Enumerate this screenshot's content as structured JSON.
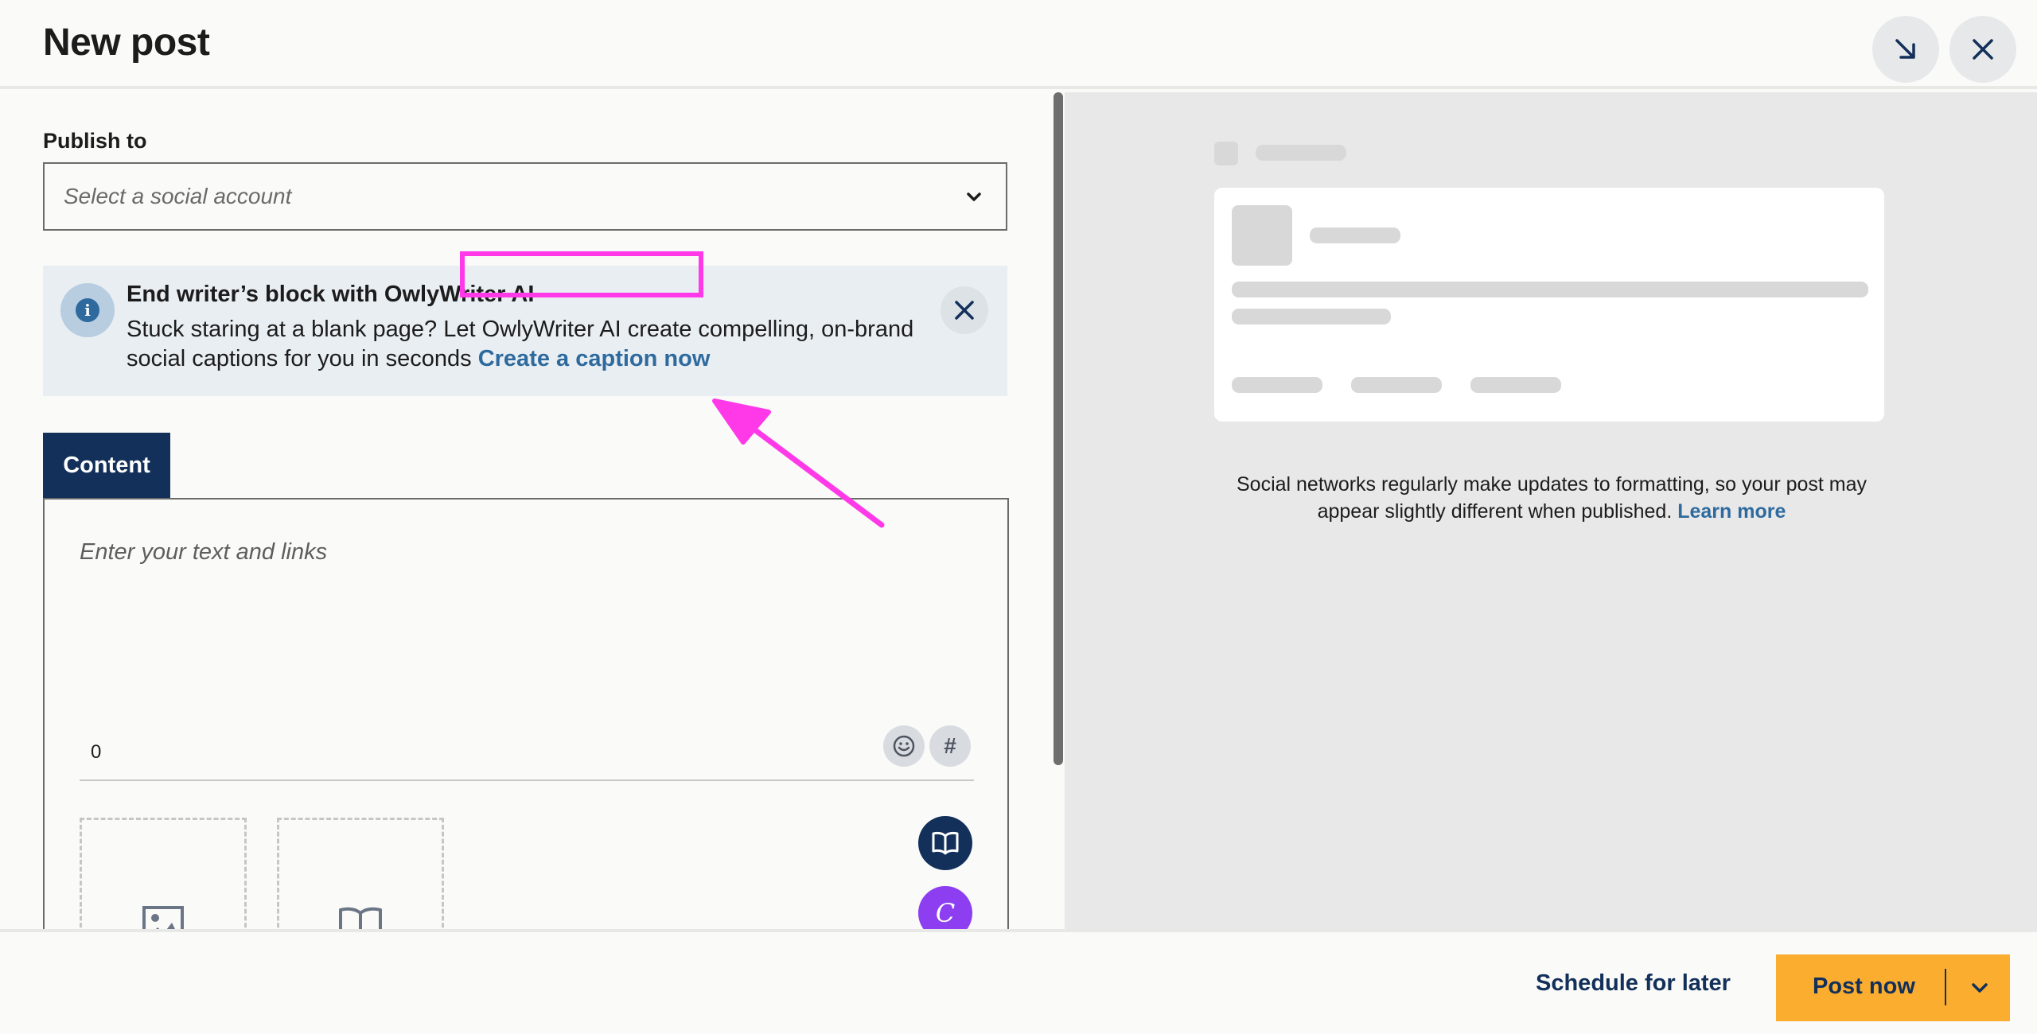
{
  "header": {
    "title": "New post",
    "minimize_icon": "arrow-down-right-icon",
    "close_icon": "close-icon"
  },
  "publish": {
    "label": "Publish to",
    "select_placeholder": "Select a social account"
  },
  "banner": {
    "title": "End writer’s block with OwlyWriter AI",
    "body": "Stuck staring at a blank page? Let OwlyWriter AI create compelling, on-brand social captions for you in seconds",
    "link": "Create a caption now"
  },
  "tabs": [
    {
      "label": "Content",
      "active": true
    }
  ],
  "editor": {
    "placeholder": "Enter your text and links",
    "char_count": "0",
    "hashtag_symbol": "#",
    "owly_letter": "C"
  },
  "preview": {
    "note": "Social networks regularly make updates to formatting, so your post may appear slightly different when published.",
    "learn_more": "Learn more"
  },
  "footer": {
    "schedule_label": "Schedule for later",
    "post_now_label": "Post now"
  },
  "colors": {
    "navy": "#12305a",
    "link_blue": "#2e6a9e",
    "post_button": "#fbad30",
    "highlight": "#ff39e8",
    "owly_purple": "#8c3ef0"
  }
}
